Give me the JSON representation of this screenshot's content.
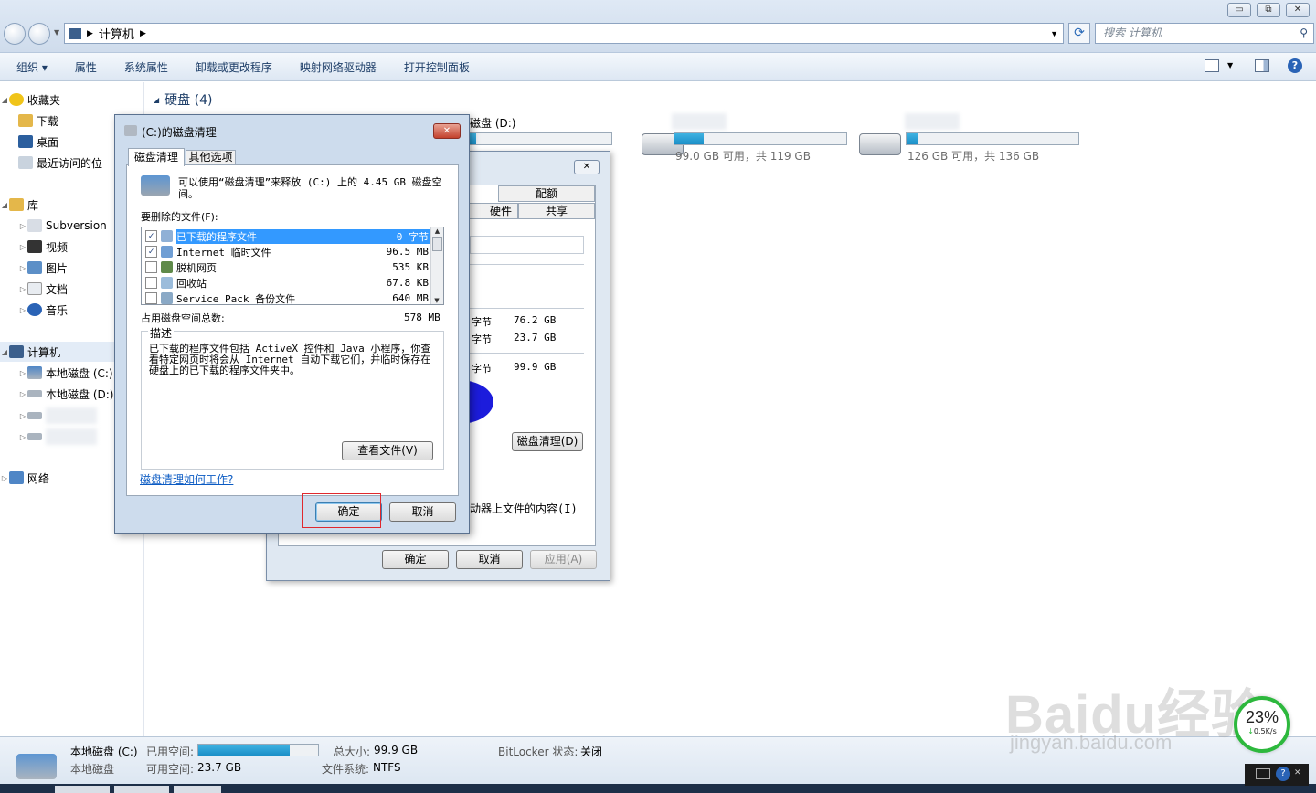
{
  "window": {
    "address": "计算机",
    "search_placeholder": "搜索 计算机",
    "controls": {
      "minimize": "▭",
      "maximize": "⧉",
      "close": "✕"
    }
  },
  "toolbar": {
    "items": [
      "组织 ▾",
      "属性",
      "系统属性",
      "卸载或更改程序",
      "映射网络驱动器",
      "打开控制面板"
    ]
  },
  "sidebar": {
    "favorites": "收藏夹",
    "downloads": "下载",
    "desktop": "桌面",
    "recent": "最近访问的位",
    "libraries": "库",
    "subversion": "Subversion",
    "videos": "视频",
    "pictures": "图片",
    "docs": "文档",
    "music": "音乐",
    "computer": "计算机",
    "drive_c": "本地磁盘 (C:)",
    "drive_d": "本地磁盘 (D:)",
    "network": "网络"
  },
  "main": {
    "section_title": "硬盘 (4)",
    "drive_d_label": "磁盘 (D:)",
    "drive3_free": "99.0 GB 可用，共 119 GB",
    "drive4_free": "126 GB 可用，共 136 GB",
    "drive_usage": {
      "d": 0.05,
      "d3": 0.17,
      "d4": 0.07
    }
  },
  "props_dialog": {
    "tab_quota": "配额",
    "tab_hardware": "硬件",
    "tab_share": "共享",
    "used_unit": "字节",
    "used_value": "76.2 GB",
    "free_unit": "字节",
    "free_value": "23.7 GB",
    "total_unit": "字节",
    "total_value": "99.9 GB",
    "cleanup_button": "磁盘清理(D)",
    "index_text": "动器上文件的内容(I)",
    "ok": "确定",
    "cancel": "取消",
    "apply": "应用(A)"
  },
  "cleanup_dialog": {
    "title": "(C:)的磁盘清理",
    "tab_cleanup": "磁盘清理",
    "tab_more": "其他选项",
    "intro": "可以使用“磁盘清理”来释放 (C:) 上的 4.45 GB 磁盘空间。",
    "files_label": "要删除的文件(F):",
    "files": [
      {
        "name": "已下载的程序文件",
        "size": "0 字节",
        "checked": true,
        "selected": true
      },
      {
        "name": "Internet 临时文件",
        "size": "96.5 MB",
        "checked": true,
        "selected": false
      },
      {
        "name": "脱机网页",
        "size": "535 KB",
        "checked": false,
        "selected": false
      },
      {
        "name": "回收站",
        "size": "67.8 KB",
        "checked": false,
        "selected": false
      },
      {
        "name": "Service Pack 备份文件",
        "size": "640 MB",
        "checked": false,
        "selected": false
      }
    ],
    "total_label": "占用磁盘空间总数:",
    "total_value": "578 MB",
    "desc_title": "描述",
    "desc_text": "已下载的程序文件包括 ActiveX 控件和 Java 小程序，你查看特定网页时将会从 Internet 自动下载它们，并临时保存在硬盘上的已下载的程序文件夹中。",
    "view_files": "查看文件(V)",
    "help_link": "磁盘清理如何工作?",
    "ok": "确定",
    "cancel": "取消"
  },
  "statusbar": {
    "drive_name": "本地磁盘 (C:)",
    "drive_type": "本地磁盘",
    "used_label": "已用空间:",
    "free_label": "可用空间:",
    "free_value": "23.7 GB",
    "total_label": "总大小:",
    "total_value": "99.9 GB",
    "fs_label": "文件系统:",
    "fs_value": "NTFS",
    "bitlocker_label": "BitLocker 状态:",
    "bitlocker_value": "关闭",
    "used_fraction": 0.76
  },
  "watermark": {
    "brand": "Baidu经验",
    "url": "jingyan.baidu.com"
  },
  "speed_widget": {
    "percent": "23%",
    "rate": "0.5K/s"
  }
}
